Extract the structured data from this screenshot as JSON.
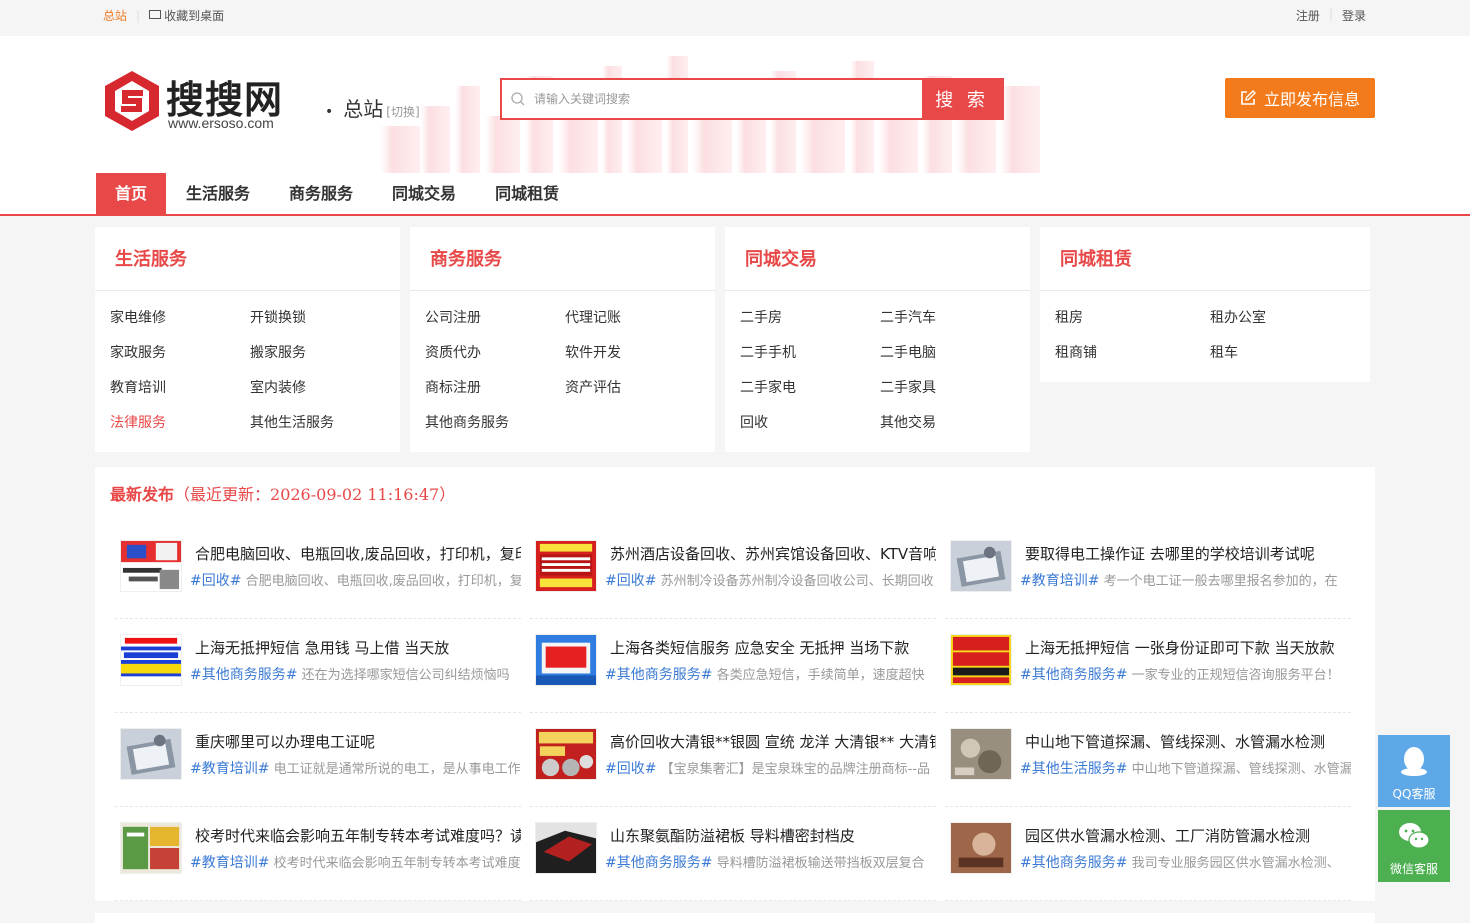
{
  "topbar": {
    "site": "总站",
    "favorite": "收藏到桌面",
    "register": "注册",
    "login": "登录"
  },
  "header": {
    "logo_text": "搜搜网",
    "logo_url": "www.ersoso.com",
    "city": "总站",
    "city_switch": "[切换]",
    "search_placeholder": "请输入关键词搜索",
    "search_button": "搜 索",
    "publish_button": "立即发布信息",
    "colors": {
      "accent": "#e84848",
      "publish": "#f47b1b"
    }
  },
  "nav": {
    "items": [
      "首页",
      "生活服务",
      "商务服务",
      "同城交易",
      "同城租赁"
    ],
    "active": "首页"
  },
  "categories": [
    {
      "title": "生活服务",
      "items": [
        "家电维修",
        "开锁换锁",
        "家政服务",
        "搬家服务",
        "教育培训",
        "室内装修",
        "法律服务",
        "其他生活服务"
      ],
      "highlight": "法律服务"
    },
    {
      "title": "商务服务",
      "items": [
        "公司注册",
        "代理记账",
        "资质代办",
        "软件开发",
        "商标注册",
        "资产评估",
        "其他商务服务"
      ]
    },
    {
      "title": "同城交易",
      "items": [
        "二手房",
        "二手汽车",
        "二手手机",
        "二手电脑",
        "二手家电",
        "二手家具",
        "回收",
        "其他交易"
      ]
    },
    {
      "title": "同城租赁",
      "items": [
        "租房",
        "租办公室",
        "租商铺",
        "租车"
      ]
    }
  ],
  "latest": {
    "title": "最新发布",
    "updated": "（最近更新：2026-09-02 11:16:47）",
    "items": [
      {
        "title": "合肥电脑回收、电瓶回收,废品回收，打印机，复印",
        "tag": "#回收#",
        "desc": "合肥电脑回收、电瓶回收,废品回收，打印机，复印机回收",
        "thumb": "recycle-poster"
      },
      {
        "title": "苏州酒店设备回收、苏州宾馆设备回收、KTV音响设备回收",
        "tag": "#回收#",
        "desc": "苏州制冷设备苏州制冷设备回收公司、长期回收",
        "thumb": "hotel-recycle-poster"
      },
      {
        "title": "要取得电工操作证 去哪里的学校培训考试呢",
        "tag": "#教育培训#",
        "desc": "考一个电工证一般去哪里报名参加的，在",
        "thumb": "certificate-photo"
      },
      {
        "title": "上海无抵押短信 急用钱 马上借 当天放",
        "tag": "#其他商务服务#",
        "desc": "还在为选择哪家短信公司纠结烦恼吗",
        "thumb": "loan-blue-poster"
      },
      {
        "title": "上海各类短信服务 应急安全 无抵押 当场下款",
        "tag": "#其他商务服务#",
        "desc": "各类应急短信，手续简单，速度超快",
        "thumb": "loan-red-poster"
      },
      {
        "title": "上海无抵押短信 一张身份证即可下款 当天放款",
        "tag": "#其他商务服务#",
        "desc": "一家专业的正规短信咨询服务平台！",
        "thumb": "loan-yellow-poster"
      },
      {
        "title": "重庆哪里可以办理电工证呢",
        "tag": "#教育培训#",
        "desc": "电工证就是通常所说的电工，是从事电工作业",
        "thumb": "certificate-photo"
      },
      {
        "title": "高价回收大清银**银圆 宣统 龙洋 大清银** 大清铜币",
        "tag": "#回收#",
        "desc": "【宝泉集奢汇】是宝泉珠宝的品牌注册商标--品",
        "thumb": "coin-poster"
      },
      {
        "title": "中山地下管道探漏、管线探测、水管漏水检测",
        "tag": "#其他生活服务#",
        "desc": "中山地下管道探漏、管线探测、水管漏水检测",
        "thumb": "pipe-photo"
      },
      {
        "title": "校考时代来临会影响五年制专转本考试难度吗？读",
        "tag": "#教育培训#",
        "desc": "校考时代来临会影响五年制专转本考试难度吗",
        "thumb": "books-photo"
      },
      {
        "title": "山东聚氨酯防溢裙板 导料槽密封档皮",
        "tag": "#其他商务服务#",
        "desc": "导料槽防溢裙板输送带挡板双层复合",
        "thumb": "rubber-photo"
      },
      {
        "title": "园区供水管漏水检测、工厂消防管漏水检测",
        "tag": "#其他商务服务#",
        "desc": "我司专业服务园区供水管漏水检测、",
        "thumb": "pipe-wall-photo"
      }
    ]
  },
  "side": {
    "qq": "QQ客服",
    "wechat": "微信客服"
  }
}
